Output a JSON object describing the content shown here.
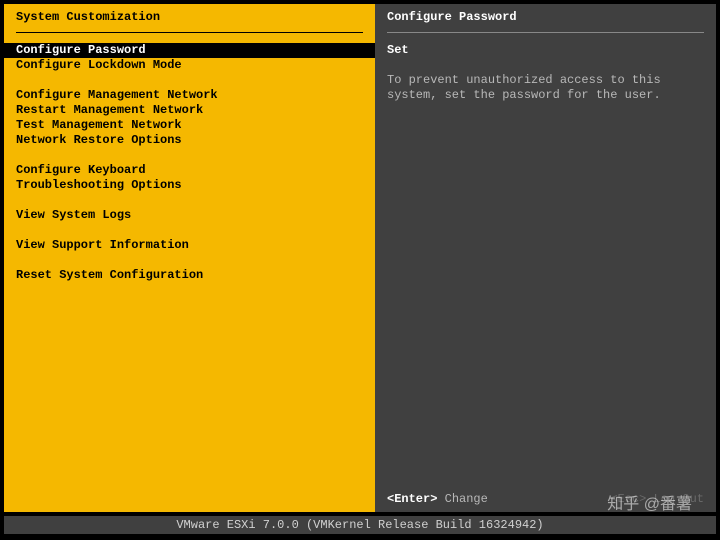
{
  "left": {
    "title": "System Customization",
    "groups": [
      [
        "Configure Password",
        "Configure Lockdown Mode"
      ],
      [
        "Configure Management Network",
        "Restart Management Network",
        "Test Management Network",
        "Network Restore Options"
      ],
      [
        "Configure Keyboard",
        "Troubleshooting Options"
      ],
      [
        "View System Logs"
      ],
      [
        "View Support Information"
      ],
      [
        "Reset System Configuration"
      ]
    ],
    "selected": "Configure Password"
  },
  "right": {
    "title": "Configure Password",
    "heading": "Set",
    "body": "To prevent unauthorized access to this system, set the password for the user."
  },
  "hints": {
    "enter_key": "<Enter>",
    "enter_label": "Change",
    "esc_key": "<Esc>",
    "esc_label": "Log Out"
  },
  "status": "VMware ESXi 7.0.0 (VMKernel Release Build 16324942)",
  "watermark": "知乎 @番薯"
}
